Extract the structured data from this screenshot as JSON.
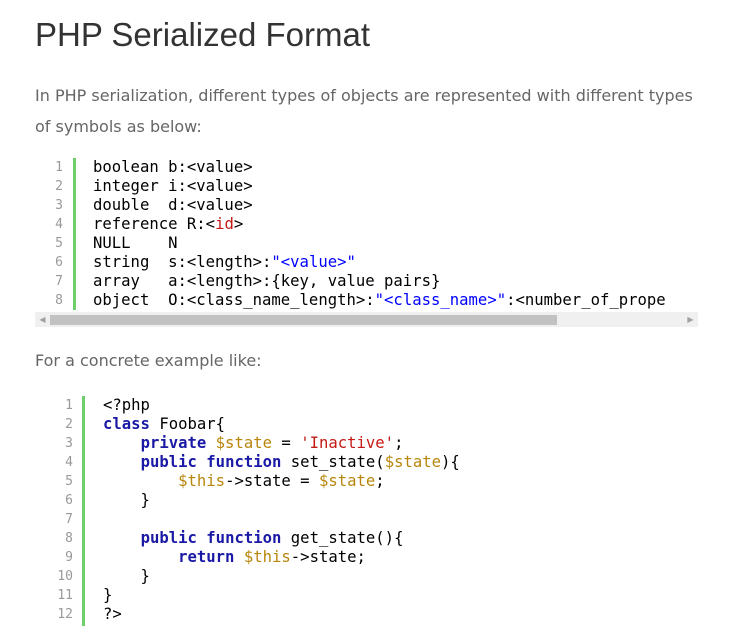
{
  "title": "PHP Serialized Format",
  "intro": "In PHP serialization, different types of objects are represented with different types of symbols as below:",
  "example_intro": "For a concrete example like:",
  "colors": {
    "gutter_bar": "#6ccf6c",
    "keyword": "#1a1aa6",
    "string": "#0000ff",
    "variable": "#b8860b",
    "literal": "#c41a16"
  },
  "code1": {
    "line_numbers": [
      "1",
      "2",
      "3",
      "4",
      "5",
      "6",
      "7",
      "8"
    ],
    "lines": [
      [
        {
          "t": "plain",
          "v": "boolean b:<value>"
        }
      ],
      [
        {
          "t": "plain",
          "v": "integer i:<value>"
        }
      ],
      [
        {
          "t": "plain",
          "v": "double  d:<value>"
        }
      ],
      [
        {
          "t": "plain",
          "v": "reference R:<"
        },
        {
          "t": "red",
          "v": "id"
        },
        {
          "t": "plain",
          "v": ">"
        }
      ],
      [
        {
          "t": "plain",
          "v": "NULL    N"
        }
      ],
      [
        {
          "t": "plain",
          "v": "string  s:<length>:"
        },
        {
          "t": "str",
          "v": "\"<value>\""
        }
      ],
      [
        {
          "t": "plain",
          "v": "array   a:<length>:{key, value pairs}"
        }
      ],
      [
        {
          "t": "plain",
          "v": "object  O:<class_name_length>:"
        },
        {
          "t": "str",
          "v": "\"<class_name>\""
        },
        {
          "t": "plain",
          "v": ":<number_of_prope"
        }
      ]
    ]
  },
  "scrollbar": {
    "left_arrow": "◀",
    "right_arrow": "▶"
  },
  "code2": {
    "line_numbers": [
      "1",
      "2",
      "3",
      "4",
      "5",
      "6",
      "7",
      "8",
      "9",
      "10",
      "11",
      "12"
    ],
    "lines": [
      [
        {
          "t": "plain",
          "v": "<?php"
        }
      ],
      [
        {
          "t": "kw",
          "v": "class"
        },
        {
          "t": "plain",
          "v": " Foobar{"
        }
      ],
      [
        {
          "t": "plain",
          "v": "    "
        },
        {
          "t": "kw",
          "v": "private"
        },
        {
          "t": "plain",
          "v": " "
        },
        {
          "t": "var",
          "v": "$state"
        },
        {
          "t": "plain",
          "v": " = "
        },
        {
          "t": "str2",
          "v": "'Inactive'"
        },
        {
          "t": "plain",
          "v": ";"
        }
      ],
      [
        {
          "t": "plain",
          "v": "    "
        },
        {
          "t": "kw",
          "v": "public"
        },
        {
          "t": "plain",
          "v": " "
        },
        {
          "t": "kw",
          "v": "function"
        },
        {
          "t": "plain",
          "v": " set_state("
        },
        {
          "t": "var",
          "v": "$state"
        },
        {
          "t": "plain",
          "v": "){"
        }
      ],
      [
        {
          "t": "plain",
          "v": "        "
        },
        {
          "t": "var",
          "v": "$this"
        },
        {
          "t": "plain",
          "v": "->state = "
        },
        {
          "t": "var",
          "v": "$state"
        },
        {
          "t": "plain",
          "v": ";"
        }
      ],
      [
        {
          "t": "plain",
          "v": "    }"
        }
      ],
      [
        {
          "t": "plain",
          "v": ""
        }
      ],
      [
        {
          "t": "plain",
          "v": "    "
        },
        {
          "t": "kw",
          "v": "public"
        },
        {
          "t": "plain",
          "v": " "
        },
        {
          "t": "kw",
          "v": "function"
        },
        {
          "t": "plain",
          "v": " get_state(){"
        }
      ],
      [
        {
          "t": "plain",
          "v": "        "
        },
        {
          "t": "kw",
          "v": "return"
        },
        {
          "t": "plain",
          "v": " "
        },
        {
          "t": "var",
          "v": "$this"
        },
        {
          "t": "plain",
          "v": "->state;"
        }
      ],
      [
        {
          "t": "plain",
          "v": "    }"
        }
      ],
      [
        {
          "t": "plain",
          "v": "}"
        }
      ],
      [
        {
          "t": "plain",
          "v": "?>"
        }
      ]
    ]
  }
}
